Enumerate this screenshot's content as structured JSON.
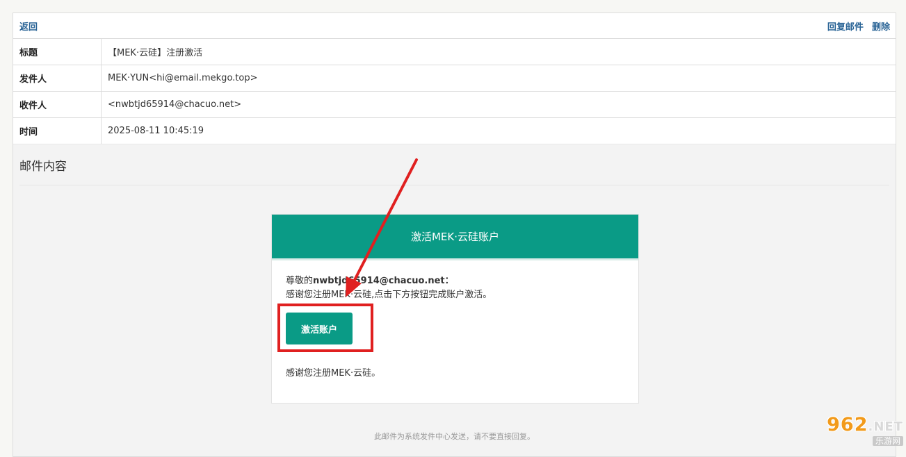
{
  "toolbar": {
    "back_label": "返回",
    "reply_label": "回复邮件",
    "delete_label": "删除"
  },
  "meta": {
    "subject_label": "标题",
    "subject_value": "【MEK·云硅】注册激活",
    "from_label": "发件人",
    "from_value": "MEK·YUN<hi@email.mekgo.top>",
    "to_label": "收件人",
    "to_value": "<nwbtjd65914@chacuo.net>",
    "time_label": "时间",
    "time_value": "2025-08-11 10:45:19"
  },
  "content": {
    "section_title": "邮件内容",
    "card_title": "激活MEK·云硅账户",
    "greeting_prefix": "尊敬的",
    "greeting_email": "nwbtjd65914@chacuo.net",
    "greeting_suffix": "：",
    "body_line": "感谢您注册MEK·云硅,点击下方按钮完成账户激活。",
    "activate_button": "激活账户",
    "thanks_line": "感谢您注册MEK·云硅。",
    "footer_note": "此邮件为系统发件中心发送，请不要直接回复。"
  },
  "watermark": {
    "brand_number": "962",
    "brand_suffix": ".NET",
    "brand_sub": "乐游网"
  },
  "colors": {
    "accent": "#0a9b86",
    "link": "#2a6496",
    "annotation_red": "#e02020"
  }
}
